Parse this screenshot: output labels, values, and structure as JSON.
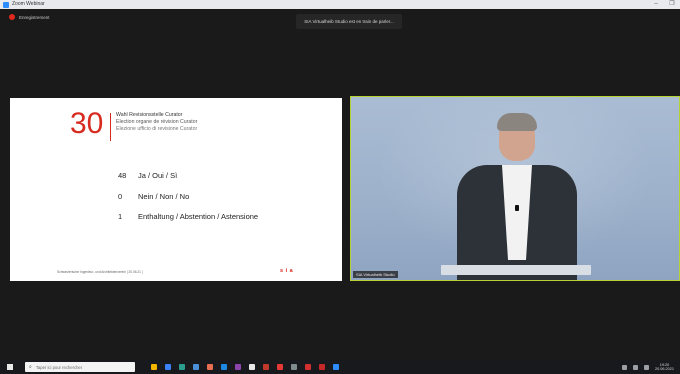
{
  "window": {
    "title": "Zoom Webinar",
    "minimize": "–",
    "restore": "❐"
  },
  "recording": {
    "label": "Enregistrement"
  },
  "share_banner": {
    "text": "SIA Virtualheib Studio est en train de parler..."
  },
  "slide": {
    "number": "30",
    "title_de": "Wahl Revisionsstelle Curator",
    "title_fr": "Election organe de révision Curator",
    "title_it": "Elezione ufficio di revisione Curator",
    "votes": [
      {
        "count": "48",
        "label": "Ja / Oui / Sì"
      },
      {
        "count": "0",
        "label": "Nein / Non / No"
      },
      {
        "count": "1",
        "label": "Enthaltung / Abstention / Astensione"
      }
    ],
    "footer": "Schweizerische Ingenieur- und Architektenverein  |  20.06.21  |",
    "logo": "s i a"
  },
  "video": {
    "label": "SIA Virtualheib Studio"
  },
  "taskbar": {
    "search_placeholder": "Taper ici pour rechercher",
    "clock_time": "19:20",
    "clock_date": "20.06.2021",
    "app_colors": [
      "#f4b400",
      "#3b82f6",
      "#2a9d8f",
      "#4a90d9",
      "#e76f51",
      "#1e88e5",
      "#8e44ad",
      "#e8e8e8",
      "#c0392b",
      "#e53935",
      "#7f8c8d",
      "#d32f2f",
      "#c62828",
      "#2d8cff"
    ]
  }
}
